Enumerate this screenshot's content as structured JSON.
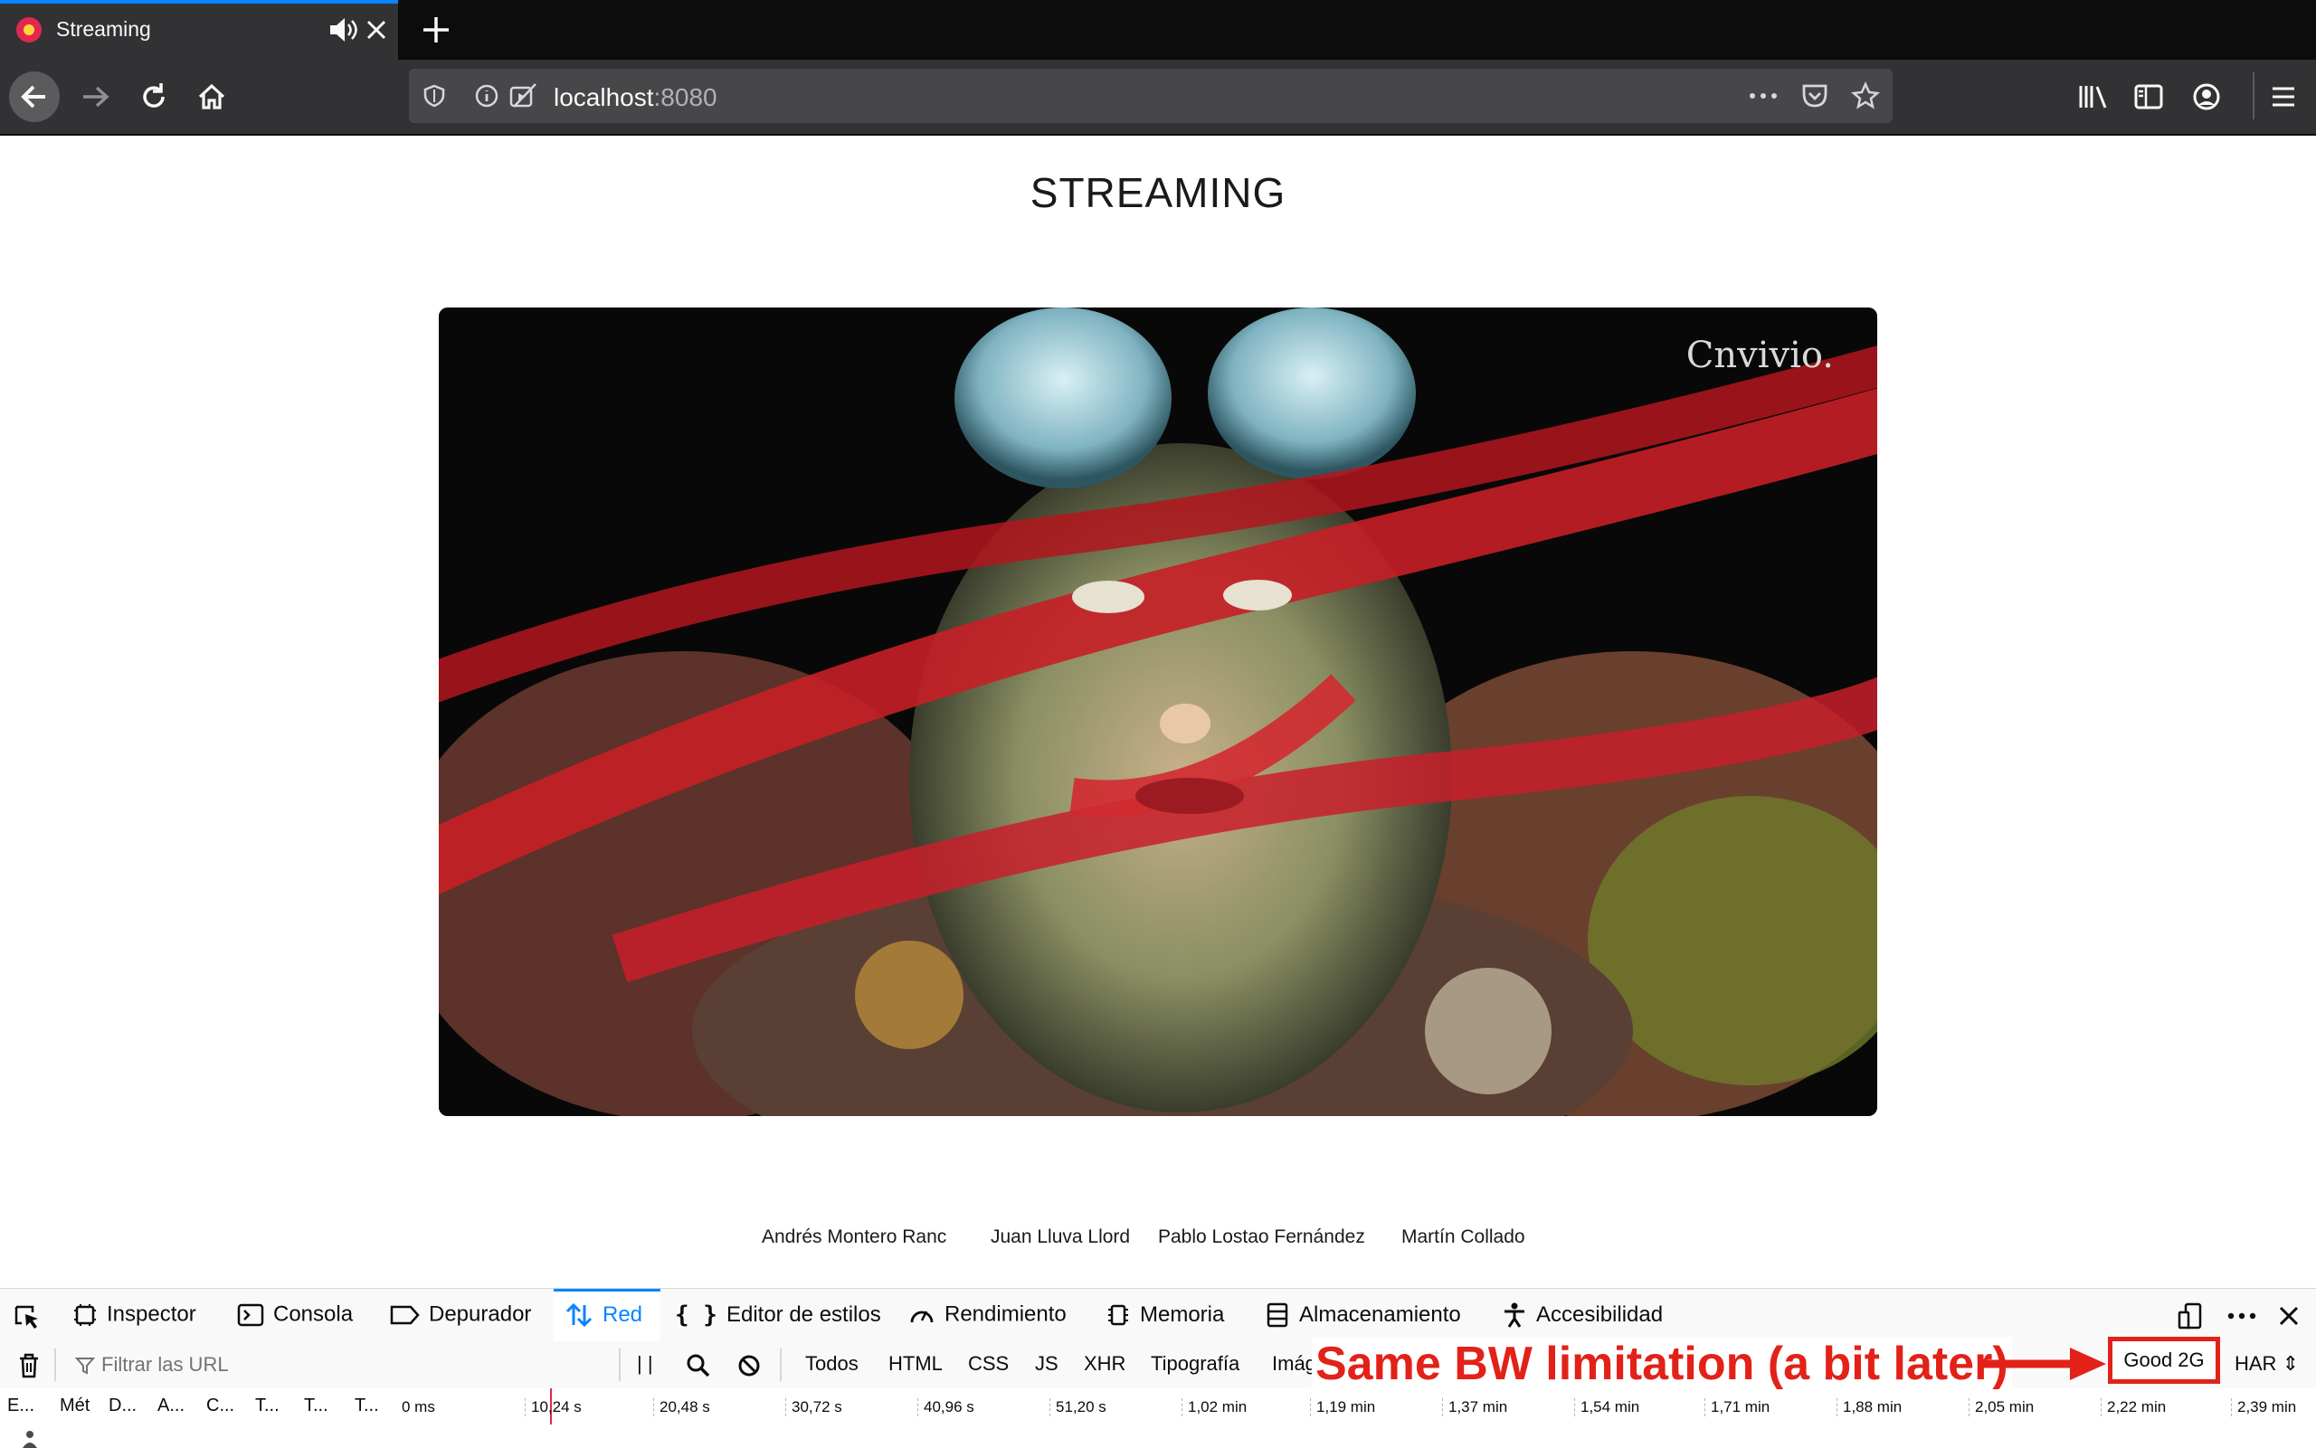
{
  "browser": {
    "tab_title": "Streaming",
    "url_host": "localhost",
    "url_port": ":8080"
  },
  "page": {
    "title": "STREAMING",
    "video_watermark": "Cnvivio.",
    "credits": [
      "Andrés Montero Ranc",
      "Juan Lluva Llord",
      "Pablo Lostao Fernández",
      "Martín Collado"
    ]
  },
  "devtools": {
    "tabs": [
      "Inspector",
      "Consola",
      "Depurador",
      "Red",
      "Editor de estilos",
      "Rendimiento",
      "Memoria",
      "Almacenamiento",
      "Accesibilidad"
    ],
    "active_tab": "Red",
    "filter_placeholder": "Filtrar las URL",
    "pause_label": "| |",
    "type_filters": [
      "Todos",
      "HTML",
      "CSS",
      "JS",
      "XHR",
      "Tipografía",
      "Imág"
    ],
    "throttle_value": "Good 2G",
    "har_label": "HAR",
    "columns": [
      "E...",
      "Mét",
      "D...",
      "A...",
      "C...",
      "T...",
      "T...",
      "T..."
    ],
    "timeline_ticks": [
      "0 ms",
      "10,24 s",
      "20,48 s",
      "30,72 s",
      "40,96 s",
      "51,20 s",
      "1,02 min",
      "1,19 min",
      "1,37 min",
      "1,54 min",
      "1,71 min",
      "1,88 min",
      "2,05 min",
      "2,22 min",
      "2,39 min"
    ]
  },
  "annotation": {
    "text": "Same BW limitation (a bit later)",
    "color": "#e22219"
  },
  "colors": {
    "accent": "#0a84ff",
    "chrome_dark": "#0c0c0d",
    "toolbar": "#323234",
    "annotation_red": "#e22219"
  }
}
